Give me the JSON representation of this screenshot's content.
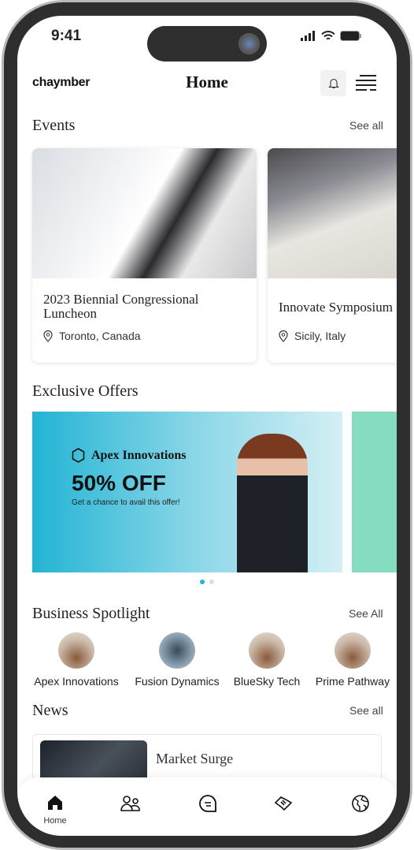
{
  "status_bar": {
    "time": "9:41"
  },
  "header": {
    "logo": "chaymber",
    "title": "Home",
    "bell_icon": "bell-icon",
    "menu_icon": "menu-icon"
  },
  "events": {
    "title": "Events",
    "see_all": "See all",
    "items": [
      {
        "name": "2023 Biennial Congressional Luncheon",
        "location": "Toronto, Canada"
      },
      {
        "name": "Innovate Symposium",
        "location": "Sicily, Italy"
      }
    ]
  },
  "offers": {
    "title": "Exclusive Offers",
    "items": [
      {
        "brand": "Apex Innovations",
        "headline": "50% OFF",
        "subtitle": "Get a chance to avail this offer!",
        "color": "#22b4d4"
      }
    ],
    "page_count": 2,
    "active_page": 1
  },
  "spotlight": {
    "title": "Business Spotlight",
    "see_all": "See All",
    "items": [
      {
        "name": "Apex Innovations"
      },
      {
        "name": "Fusion Dynamics"
      },
      {
        "name": "BlueSky Tech"
      },
      {
        "name": "Prime Pathway"
      }
    ]
  },
  "news": {
    "title": "News",
    "see_all": "See all",
    "items": [
      {
        "title": "Market Surge"
      }
    ]
  },
  "tabbar": {
    "items": [
      {
        "label": "Home",
        "icon": "home-icon",
        "active": true
      },
      {
        "icon": "people-icon"
      },
      {
        "icon": "chat-icon"
      },
      {
        "icon": "handshake-icon"
      },
      {
        "icon": "globe-icon"
      }
    ]
  }
}
